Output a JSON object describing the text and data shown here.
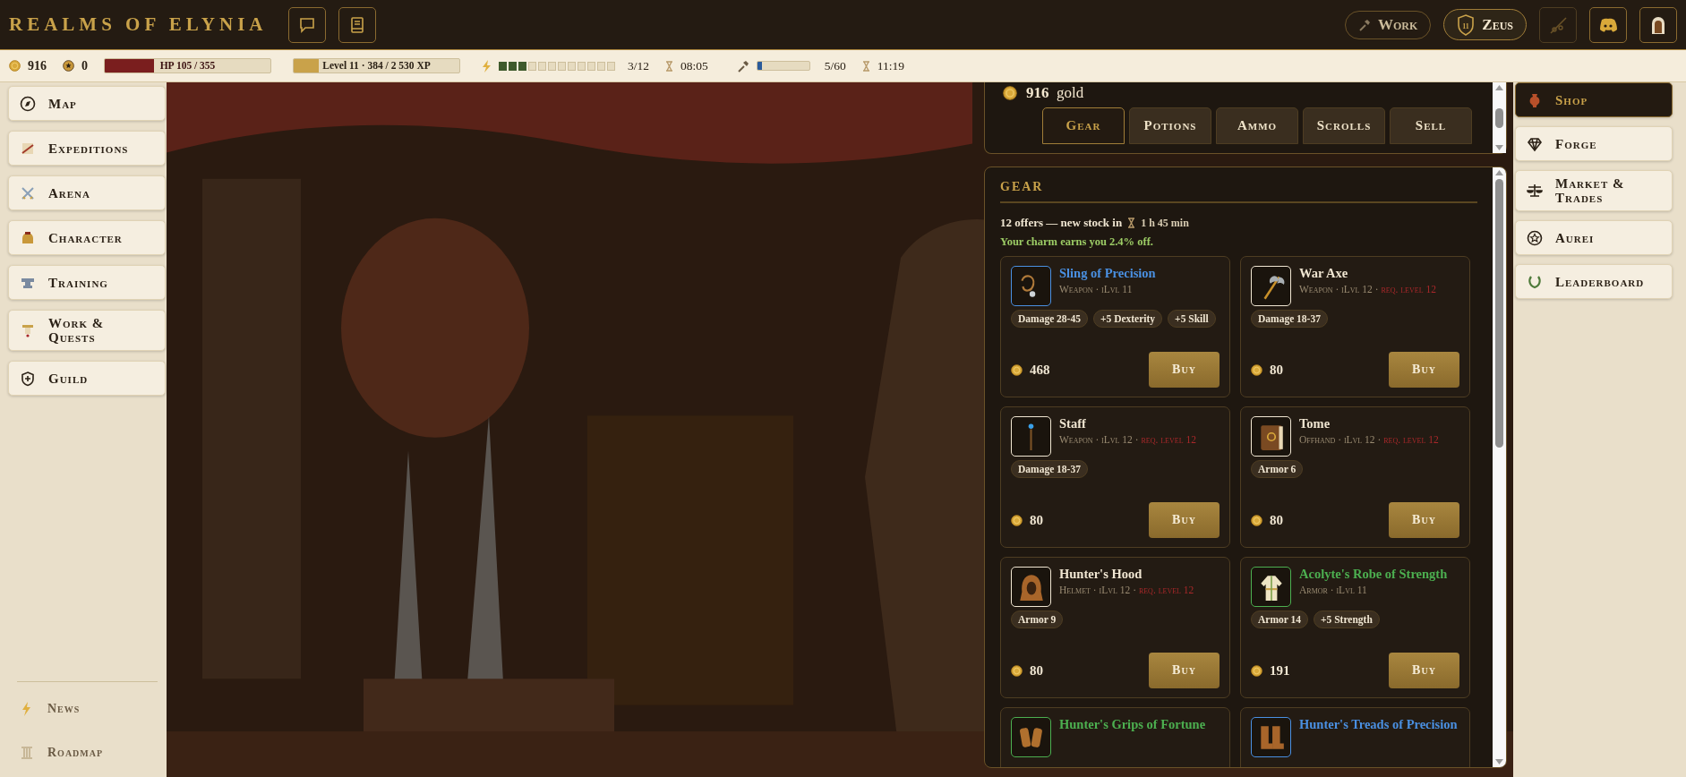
{
  "header": {
    "logo": "REALMS OF ELYNIA",
    "work_button": "Work",
    "player": {
      "level": "11",
      "name": "Zeus"
    }
  },
  "stats": {
    "gold": "916",
    "aurei": "0",
    "hp": {
      "label": "HP 105 / 355",
      "level": 0.296
    },
    "xp": {
      "label": "Level 11 · 384 / 2 530 XP",
      "level": 0.15
    },
    "energy": {
      "level": 0.25,
      "reading": "3/12",
      "timer": "08:05"
    },
    "work": {
      "level": 0.083,
      "reading": "5/60",
      "timer": "11:19"
    }
  },
  "left_nav": [
    {
      "kind": "map",
      "label": "Map"
    },
    {
      "kind": "expeditions",
      "label": "Expeditions"
    },
    {
      "kind": "arena",
      "label": "Arena"
    },
    {
      "kind": "character",
      "label": "Character"
    },
    {
      "kind": "training",
      "label": "Training"
    },
    {
      "kind": "quests",
      "label": "Work & Quests"
    },
    {
      "kind": "guild",
      "label": "Guild"
    }
  ],
  "left_footer": [
    {
      "kind": "news",
      "label": "News"
    },
    {
      "kind": "roadmap",
      "label": "Roadmap"
    }
  ],
  "shop": {
    "gold": "916",
    "gold_unit": "gold",
    "tabs": [
      {
        "label": "Gear",
        "selected": true
      },
      {
        "label": "Potions",
        "selected": false
      },
      {
        "label": "Ammo",
        "selected": false
      },
      {
        "label": "Scrolls",
        "selected": false
      },
      {
        "label": "Sell",
        "selected": false
      }
    ],
    "section_title": "GEAR",
    "offers": "12 offers — new stock in",
    "restock": "1 h 45 min",
    "discount": "Your charm earns you 2.4% off.",
    "meta_separator": "·",
    "items": [
      {
        "kind": "sling",
        "name": "Sling of Precision",
        "color": "#4a90e2",
        "type": "Weapon",
        "ilvl": "iLvl 11",
        "stats": [
          "Damage 28-45",
          "+5 Dexterity",
          "+5 Skill"
        ],
        "price": "468",
        "button": "Buy"
      },
      {
        "kind": "axe",
        "name": "War Axe",
        "color": "#f0e6d2",
        "type": "Weapon",
        "ilvl": "iLvl 12",
        "req": "req. level 12",
        "stats": [
          "Damage 18-37"
        ],
        "price": "80",
        "button": "Buy"
      },
      {
        "kind": "staff",
        "name": "Staff",
        "color": "#f0e6d2",
        "type": "Weapon",
        "ilvl": "iLvl 12",
        "req": "req. level 12",
        "stats": [
          "Damage 18-37"
        ],
        "price": "80",
        "button": "Buy"
      },
      {
        "kind": "tome",
        "name": "Tome",
        "color": "#f0e6d2",
        "type": "Offhand",
        "ilvl": "iLvl 12",
        "req": "req. level 12",
        "stats": [
          "Armor 6"
        ],
        "price": "80",
        "button": "Buy"
      },
      {
        "kind": "hood",
        "name": "Hunter's Hood",
        "color": "#f0e6d2",
        "type": "Helmet",
        "ilvl": "iLvl 12",
        "req": "req. level 12",
        "stats": [
          "Armor 9"
        ],
        "price": "80",
        "button": "Buy"
      },
      {
        "kind": "robe",
        "name": "Acolyte's Robe of Strength",
        "color": "#4caf50",
        "type": "Armor",
        "ilvl": "iLvl 11",
        "stats": [
          "Armor 14",
          "+5 Strength"
        ],
        "price": "191",
        "button": "Buy"
      },
      {
        "kind": "gloves",
        "name": "Hunter's Grips of Fortune",
        "color": "#4caf50"
      },
      {
        "kind": "boots",
        "name": "Hunter's Treads of Precision",
        "color": "#4a90e2"
      }
    ]
  },
  "right_nav": [
    {
      "kind": "shop",
      "label": "Shop",
      "selected": true
    },
    {
      "kind": "forge",
      "label": "Forge",
      "selected": false
    },
    {
      "kind": "market",
      "label": "Market & Trades",
      "selected": false
    },
    {
      "kind": "aurei",
      "label": "Aurei",
      "selected": false
    },
    {
      "kind": "leaderboard",
      "label": "Leaderboard",
      "selected": false
    }
  ]
}
